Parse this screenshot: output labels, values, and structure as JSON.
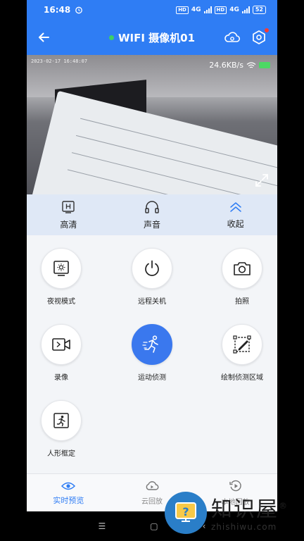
{
  "status_bar": {
    "time": "16:48",
    "network_tag": "HD",
    "net_gen": "4G",
    "battery": "52"
  },
  "header": {
    "title": "WIFI 摄像机01",
    "icons": [
      "back-arrow-icon",
      "cloud-settings-icon",
      "settings-icon"
    ]
  },
  "video": {
    "timestamp": "2023-02-17 16:48:07",
    "bitrate": "24.6KB/s"
  },
  "quick_bar": [
    {
      "label": "高清",
      "icon": "hd-icon"
    },
    {
      "label": "声音",
      "icon": "headphone-icon"
    },
    {
      "label": "收起",
      "icon": "collapse-chevron-icon"
    }
  ],
  "functions": [
    {
      "label": "夜视模式",
      "icon": "night-vision-icon",
      "active": false
    },
    {
      "label": "远程关机",
      "icon": "power-icon",
      "active": false
    },
    {
      "label": "拍照",
      "icon": "camera-icon",
      "active": false
    },
    {
      "label": "录像",
      "icon": "video-record-icon",
      "active": false
    },
    {
      "label": "运动侦测",
      "icon": "motion-detect-icon",
      "active": true
    },
    {
      "label": "绘制侦测区域",
      "icon": "draw-area-icon",
      "active": false
    },
    {
      "label": "人形框定",
      "icon": "human-frame-icon",
      "active": false
    }
  ],
  "bottom_nav": [
    {
      "label": "实时预览",
      "icon": "eye-icon",
      "active": true
    },
    {
      "label": "云回放",
      "icon": "cloud-playback-icon",
      "active": false
    },
    {
      "label": "本地回放",
      "icon": "local-playback-icon",
      "active": false
    }
  ],
  "watermark": {
    "cn": "知识屋",
    "reg": "®",
    "en": "zhishiwu.com"
  },
  "colors": {
    "primary": "#2f7df4",
    "active_func": "#3a78ee",
    "online": "#3ccf64",
    "alert": "#ff3b30"
  }
}
